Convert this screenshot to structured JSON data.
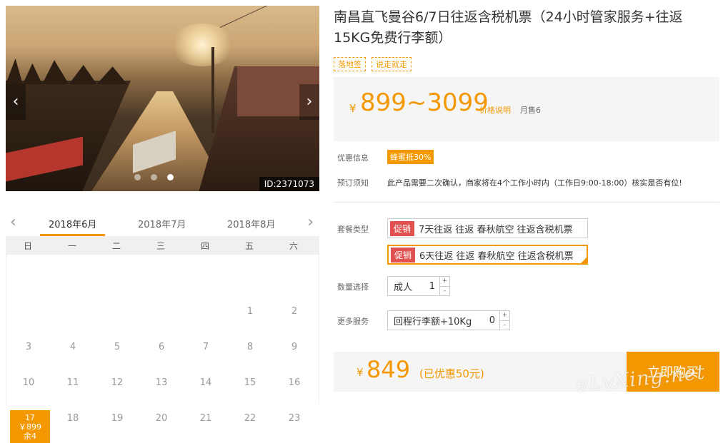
{
  "gallery": {
    "prev_arrow": "‹",
    "next_arrow": "›",
    "photo_id": "ID:2371073",
    "slide_count": 3,
    "active_slide": 2
  },
  "calendar": {
    "prev": "‹",
    "next": "›",
    "months": [
      "2018年6月",
      "2018年7月",
      "2018年8月"
    ],
    "weekdays": [
      "日",
      "一",
      "二",
      "三",
      "四",
      "五",
      "六"
    ],
    "days": [
      "1",
      "2",
      "3",
      "4",
      "5",
      "6",
      "7",
      "8",
      "9",
      "10",
      "11",
      "12",
      "13",
      "14",
      "15",
      "16",
      "17",
      "18",
      "19",
      "20",
      "21",
      "22",
      "23"
    ],
    "selected": {
      "day": "17",
      "price": "￥899",
      "stock": "余4"
    }
  },
  "product": {
    "title": "南昌直飞曼谷6/7日往返含税机票（24小时管家服务+往返15KG免费行李额）",
    "tags": [
      "落地签",
      "说走就走"
    ],
    "price": {
      "symbol": "¥",
      "range": "899~3099",
      "explain_link": "价格说明",
      "sold": "月售6"
    },
    "discount": {
      "label": "优惠信息",
      "badge": "蜂蜜抵30%"
    },
    "notice": {
      "label": "预订须知",
      "text": "此产品需要二次确认，商家将在4个工作小时内（工作日9:00-18:00）核实是否有位!"
    },
    "package": {
      "label": "套餐类型",
      "options": [
        {
          "badge": "促销",
          "name": "7天往返 往返 春秋航空 往返含税机票"
        },
        {
          "badge": "促销",
          "name": "6天往返 往返 春秋航空 往返含税机票"
        }
      ]
    },
    "quantity": {
      "label": "数量选择",
      "item": "成人",
      "value": "1",
      "plus": "+",
      "minus": "-"
    },
    "services": {
      "label": "更多服务",
      "item": "回程行李额+10Kg",
      "value": "0",
      "plus": "+",
      "minus": "-"
    },
    "total": {
      "symbol": "¥",
      "value": "849",
      "saved": "(已优惠50元)"
    },
    "buy_label": "立即购买"
  },
  "watermark": "eLvXing.net",
  "colors": {
    "accent": "#f39800",
    "promo": "#e2514f"
  }
}
